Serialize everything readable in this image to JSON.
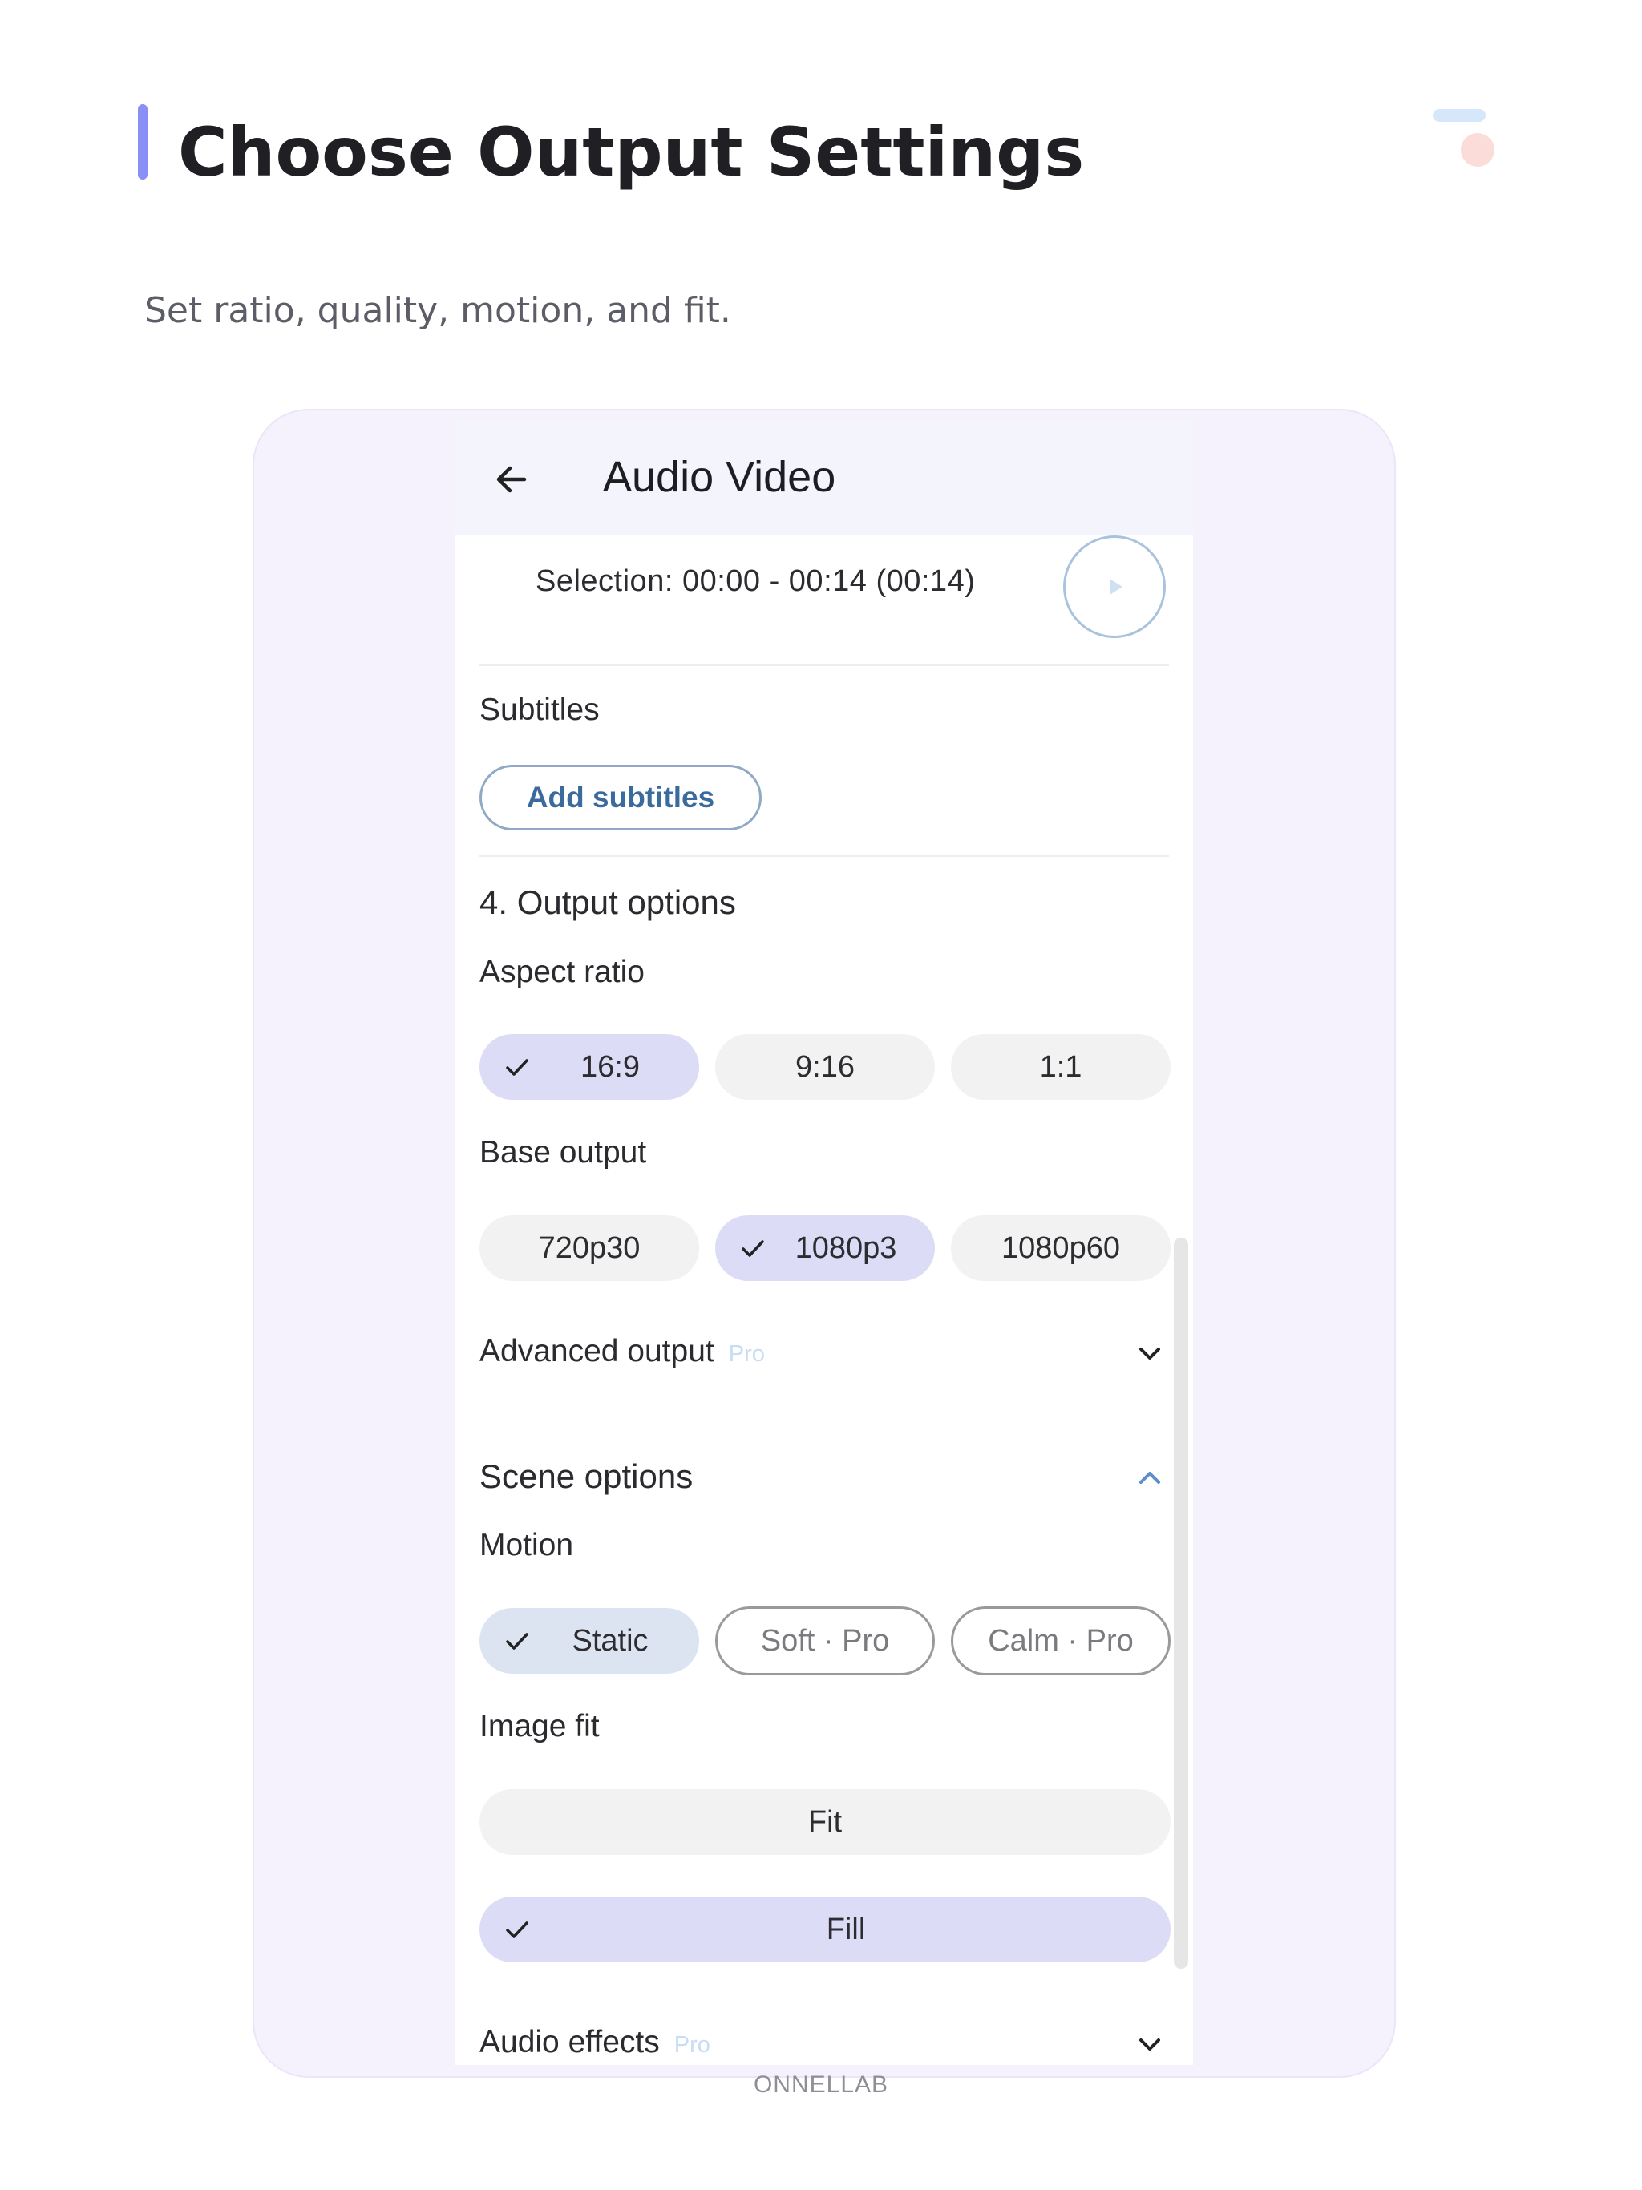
{
  "header": {
    "title": "Choose Output Settings",
    "subtitle": "Set ratio, quality, motion, and fit."
  },
  "footer": {
    "brand": "ONNELLAB"
  },
  "app": {
    "title": "Audio Video",
    "selection_text": "Selection: 00:00 - 00:14 (00:14)",
    "subtitles": {
      "label": "Subtitles",
      "add_button": "Add subtitles"
    },
    "output": {
      "section_title": "4. Output options",
      "aspect_ratio": {
        "label": "Aspect ratio",
        "options": [
          "16:9",
          "9:16",
          "1:1"
        ],
        "selected": "16:9"
      },
      "base_output": {
        "label": "Base output",
        "options": [
          "720p30",
          "1080p3",
          "1080p60"
        ],
        "selected": "1080p3"
      },
      "advanced": {
        "label": "Advanced output",
        "badge": "Pro",
        "icon": "chevron-down-icon"
      }
    },
    "scene": {
      "label": "Scene options",
      "icon": "chevron-up-icon",
      "motion": {
        "label": "Motion",
        "options": [
          "Static",
          "Soft · Pro",
          "Calm · Pro"
        ],
        "selected": "Static"
      },
      "image_fit": {
        "label": "Image fit",
        "options": [
          "Fit",
          "Fill"
        ],
        "selected": "Fill"
      }
    },
    "audio_effects": {
      "label": "Audio effects",
      "badge": "Pro",
      "icon": "chevron-down-icon"
    }
  },
  "colors": {
    "accent_bar": "#8a8ff5",
    "frame_bg": "#f5f1fd",
    "chip_selected": "#dcdcf7",
    "chip_default": "#f2f2f2",
    "link_blue": "#3b6b9c",
    "pro_badge": "#c8dcf4"
  }
}
